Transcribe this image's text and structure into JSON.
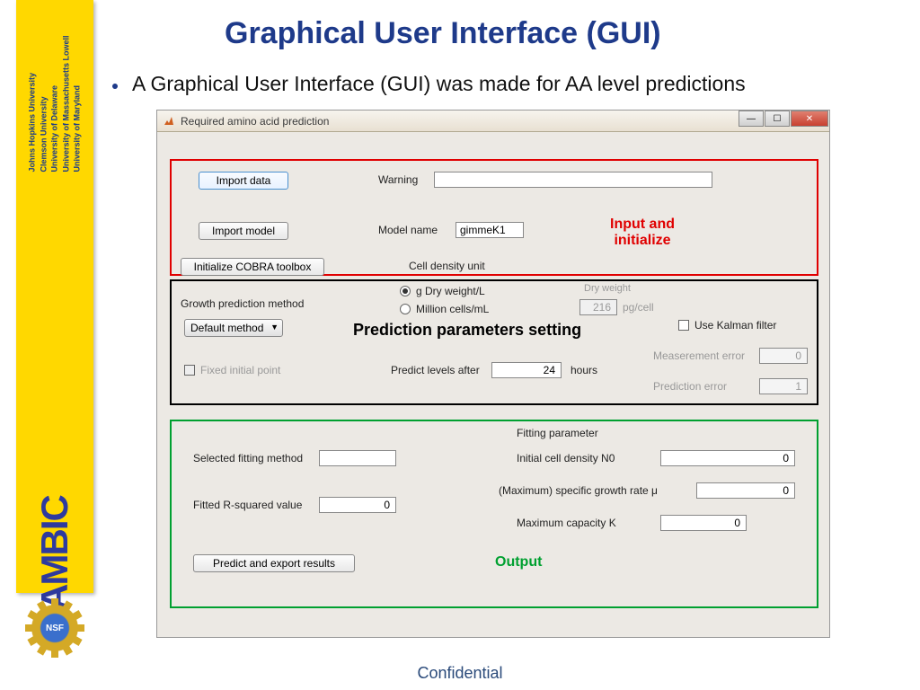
{
  "slide": {
    "title": "Graphical User Interface (GUI)",
    "bullet": "A Graphical User Interface (GUI) was made for AA level predictions",
    "confidential": "Confidential"
  },
  "sidebar": {
    "logo": "AMBIC",
    "universities": "Johns Hopkins University\nClemson University\nUniversity of Delaware\nUniversity of Massachusetts Lowell\nUniversity of Maryland",
    "nsf": "NSF"
  },
  "window": {
    "title": "Required amino acid prediction"
  },
  "section1": {
    "import_data": "Import data",
    "warning_label": "Warning",
    "warning_value": "",
    "import_model": "Import model",
    "model_name_label": "Model name",
    "model_name_value": "gimmeK1",
    "init_cobra": "Initialize COBRA toolbox",
    "cell_density_label": "Cell density unit",
    "annotation": "Input and initialize"
  },
  "section2": {
    "growth_label": "Growth prediction method",
    "growth_value": "Default method",
    "radio1": "g Dry weight/L",
    "radio2": "Million cells/mL",
    "dry_weight_label": "Dry weight",
    "dry_weight_value": "216",
    "dry_weight_unit": "pg/cell",
    "kalman": "Use Kalman filter",
    "fixed_point": "Fixed initial point",
    "predict_after_label": "Predict levels after",
    "predict_after_value": "24",
    "predict_after_unit": "hours",
    "meas_err_label": "Measerement error",
    "meas_err_value": "0",
    "pred_err_label": "Prediction error",
    "pred_err_value": "1",
    "annotation": "Prediction parameters setting"
  },
  "section3": {
    "fitting_param": "Fitting parameter",
    "sel_fitting_label": "Selected fitting method",
    "sel_fitting_value": "",
    "rsq_label": "Fitted R-squared value",
    "rsq_value": "0",
    "n0_label": "Initial cell density N0",
    "n0_value": "0",
    "mu_label": "(Maximum) specific growth rate μ",
    "mu_value": "0",
    "k_label": "Maximum capacity K",
    "k_value": "0",
    "predict_btn": "Predict and export results",
    "annotation": "Output"
  }
}
